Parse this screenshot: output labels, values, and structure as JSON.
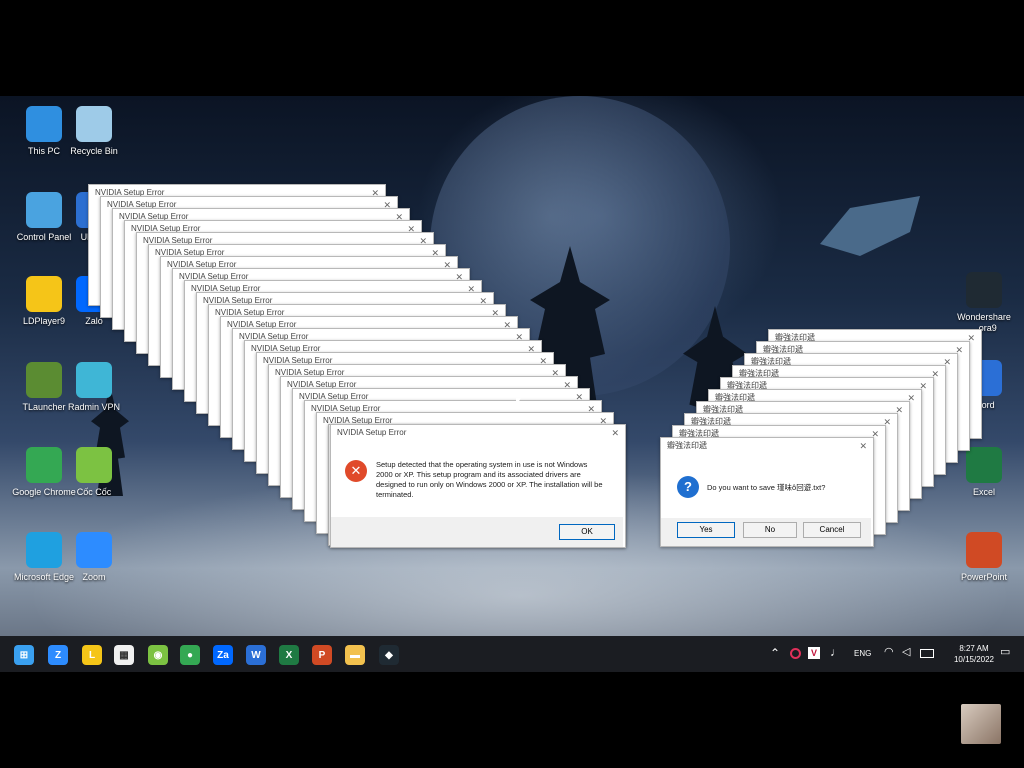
{
  "desktop": {
    "icons_left": [
      {
        "label": "This PC",
        "icon": "this-pc-icon",
        "color": "#2f8fe0"
      },
      {
        "label": "Recycle Bin",
        "icon": "recycle-bin-icon",
        "color": "#9ecbe8"
      },
      {
        "label": "Control Panel",
        "icon": "control-panel-icon",
        "color": "#4aa3e0"
      },
      {
        "label": "UltraVi",
        "icon": "ultraviewer-icon",
        "color": "#2c6fd1"
      },
      {
        "label": "LDPlayer9",
        "icon": "ldplayer-icon",
        "color": "#f5c518"
      },
      {
        "label": "Zalo",
        "icon": "zalo-icon",
        "color": "#0068ff"
      },
      {
        "label": "TLauncher",
        "icon": "tlauncher-icon",
        "color": "#5b8c32"
      },
      {
        "label": "Radmin VPN",
        "icon": "radmin-vpn-icon",
        "color": "#3fb6d6"
      },
      {
        "label": "Google Chrome",
        "icon": "chrome-icon",
        "color": "#34a853"
      },
      {
        "label": "Cốc Cốc",
        "icon": "coccoc-icon",
        "color": "#7cc242"
      },
      {
        "label": "Microsoft Edge",
        "icon": "edge-icon",
        "color": "#1fa0e0"
      },
      {
        "label": "Zoom",
        "icon": "zoom-icon",
        "color": "#2d8cff"
      }
    ],
    "icons_right": [
      {
        "label": "Wondershare ...ora9",
        "icon": "filmora-icon",
        "color": "#1f2a33"
      },
      {
        "label": "Word",
        "icon": "word-icon",
        "color": "#2b6fd6"
      },
      {
        "label": "Excel",
        "icon": "excel-icon",
        "color": "#1f7a43"
      },
      {
        "label": "PowerPoint",
        "icon": "powerpoint-icon",
        "color": "#d04a24"
      }
    ]
  },
  "nvidia_dialog": {
    "title": "NVIDIA Setup Error",
    "stack_title": "NVIDIA Setup Error",
    "message": "Setup detected that the operating system in use is not Windows 2000 or XP. This setup program and its associated drivers are designed to run only on Windows 2000 or XP. The installation will be terminated.",
    "ok_label": "OK",
    "icon": "error-icon",
    "close_glyph": "✕"
  },
  "save_dialog": {
    "title": "瓣強法印遞",
    "stack_title": "瓣強法印遞",
    "message": "Do you want to save 瑾味ô回遊.txt?",
    "yes_label": "Yes",
    "no_label": "No",
    "cancel_label": "Cancel",
    "icon": "question-icon",
    "close_glyph": "✕"
  },
  "taskbar": {
    "apps": [
      {
        "name": "start-icon",
        "glyph": "⊞",
        "color": "#3aa0f0"
      },
      {
        "name": "zoom-taskbar-icon",
        "glyph": "Z",
        "color": "#2d8cff"
      },
      {
        "name": "ldplayer-taskbar-icon",
        "glyph": "L",
        "color": "#f5c518"
      },
      {
        "name": "store-icon",
        "glyph": "▦",
        "color": "#f0f0f0"
      },
      {
        "name": "coccoc-taskbar-icon",
        "glyph": "◉",
        "color": "#7cc242"
      },
      {
        "name": "chrome-taskbar-icon",
        "glyph": "●",
        "color": "#34a853"
      },
      {
        "name": "zalo-taskbar-icon",
        "glyph": "Za",
        "color": "#0068ff"
      },
      {
        "name": "word-taskbar-icon",
        "glyph": "W",
        "color": "#2b6fd6"
      },
      {
        "name": "excel-taskbar-icon",
        "glyph": "X",
        "color": "#1f7a43"
      },
      {
        "name": "powerpoint-taskbar-icon",
        "glyph": "P",
        "color": "#d04a24"
      },
      {
        "name": "file-explorer-icon",
        "glyph": "▬",
        "color": "#f2c14e"
      },
      {
        "name": "filmora-taskbar-icon",
        "glyph": "◆",
        "color": "#1f2a33"
      }
    ],
    "language": "ENG",
    "time": "8:27 AM",
    "date": "10/15/2022",
    "tray_icons": [
      "chevron-up-icon",
      "record-icon",
      "vector-icon",
      "mic-icon",
      "wifi-icon",
      "volume-icon",
      "battery-icon",
      "notification-icon"
    ]
  }
}
